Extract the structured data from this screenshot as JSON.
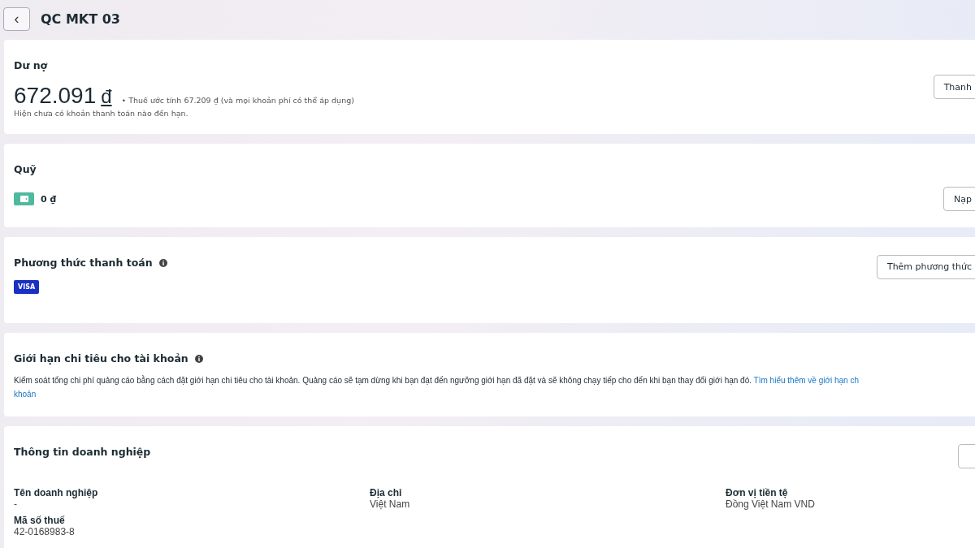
{
  "header": {
    "back_icon": "‹",
    "title": "QC MKT 03"
  },
  "balance": {
    "title": "Dư nợ",
    "amount": "672.091",
    "currency": "đ",
    "tax_note": "• Thuế ước tính 67.209 ₫ (và mọi khoản phí có thể áp dụng)",
    "status": "Hiện chưa có khoản thanh toán nào đến hạn.",
    "button": "Thanh"
  },
  "funds": {
    "title": "Quỹ",
    "amount": "0 ₫",
    "button": "Nạp"
  },
  "payment_methods": {
    "title": "Phương thức thanh toán",
    "button": "Thêm phương thức",
    "cards": [
      {
        "kind": "visa",
        "label": "VISA"
      }
    ]
  },
  "spending_limit": {
    "title": "Giới hạn chi tiêu cho tài khoản",
    "description": "Kiểm soát tổng chi phí quảng cáo bằng cách đặt giới hạn chi tiêu cho tài khoản. Quảng cáo sẽ tạm dừng khi bạn đạt đến ngưỡng giới hạn đã đặt và sẽ không chạy tiếp cho đến khi bạn thay đổi giới hạn đó.",
    "link": "Tìm hiểu thêm về giới hạn ch",
    "link_continued": "khoản"
  },
  "business_info": {
    "title": "Thông tin doanh nghiệp",
    "columns": [
      {
        "fields": [
          {
            "label": "Tên doanh nghiệp",
            "value": "-"
          },
          {
            "label": "Mã số thuế",
            "value": "42-0168983-8"
          }
        ]
      },
      {
        "fields": [
          {
            "label": "Địa chỉ",
            "value": "Việt Nam"
          }
        ]
      },
      {
        "fields": [
          {
            "label": "Đơn vị tiền tệ",
            "value": "Đồng Việt Nam VND"
          }
        ]
      }
    ]
  }
}
